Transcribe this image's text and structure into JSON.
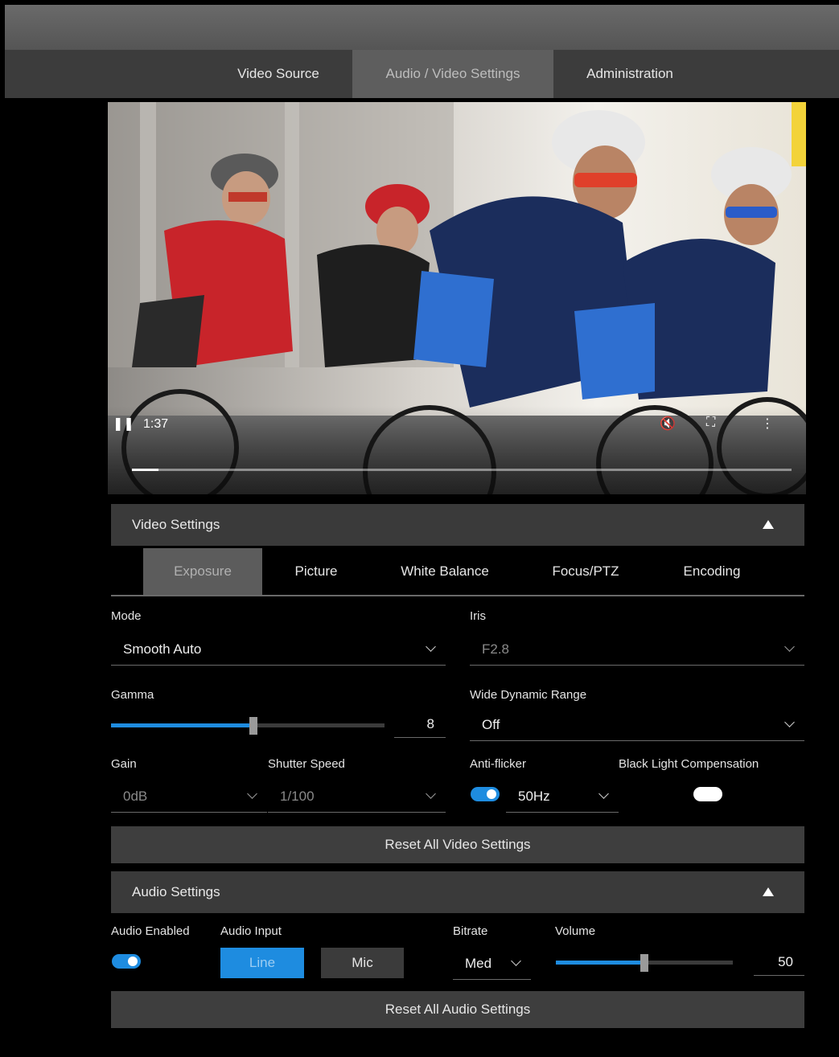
{
  "nav": {
    "tabs": [
      {
        "label": "Video Source"
      },
      {
        "label": "Audio / Video Settings",
        "active": true
      },
      {
        "label": "Administration"
      }
    ]
  },
  "player": {
    "pause_icon": "pause-icon",
    "time": "1:37",
    "progress": 0.04,
    "icons": [
      "pause-icon",
      "mute-icon",
      "fullscreen-icon",
      "more-icon"
    ]
  },
  "video_settings": {
    "title": "Video Settings",
    "subtabs": [
      {
        "label": "Exposure",
        "active": true
      },
      {
        "label": "Picture"
      },
      {
        "label": "White Balance"
      },
      {
        "label": "Focus/PTZ"
      },
      {
        "label": "Encoding"
      }
    ],
    "mode": {
      "label": "Mode",
      "value": "Smooth Auto"
    },
    "iris": {
      "label": "Iris",
      "value": "F2.8"
    },
    "gamma": {
      "label": "Gamma",
      "value": "8",
      "fraction": 0.52
    },
    "wdr": {
      "label": "Wide Dynamic Range",
      "value": "Off"
    },
    "gain": {
      "label": "Gain",
      "value": "0dB"
    },
    "shutter": {
      "label": "Shutter Speed",
      "value": "1/100"
    },
    "antiflicker": {
      "label": "Anti-flicker",
      "enabled": true,
      "value": "50Hz"
    },
    "blc": {
      "label": "Black Light Compensation",
      "enabled": false
    },
    "reset_label": "Reset All Video Settings"
  },
  "audio_settings": {
    "title": "Audio Settings",
    "enabled_label": "Audio Enabled",
    "enabled": true,
    "input_label": "Audio Input",
    "inputs": [
      {
        "label": "Line",
        "active": true
      },
      {
        "label": "Mic"
      }
    ],
    "bitrate": {
      "label": "Bitrate",
      "value": "Med"
    },
    "volume": {
      "label": "Volume",
      "value": "50",
      "fraction": 0.5
    },
    "reset_label": "Reset All Audio Settings"
  },
  "colors": {
    "accent": "#1e8ce0",
    "panel": "#3a3a3a",
    "active_tab": "#5e5e5e"
  }
}
